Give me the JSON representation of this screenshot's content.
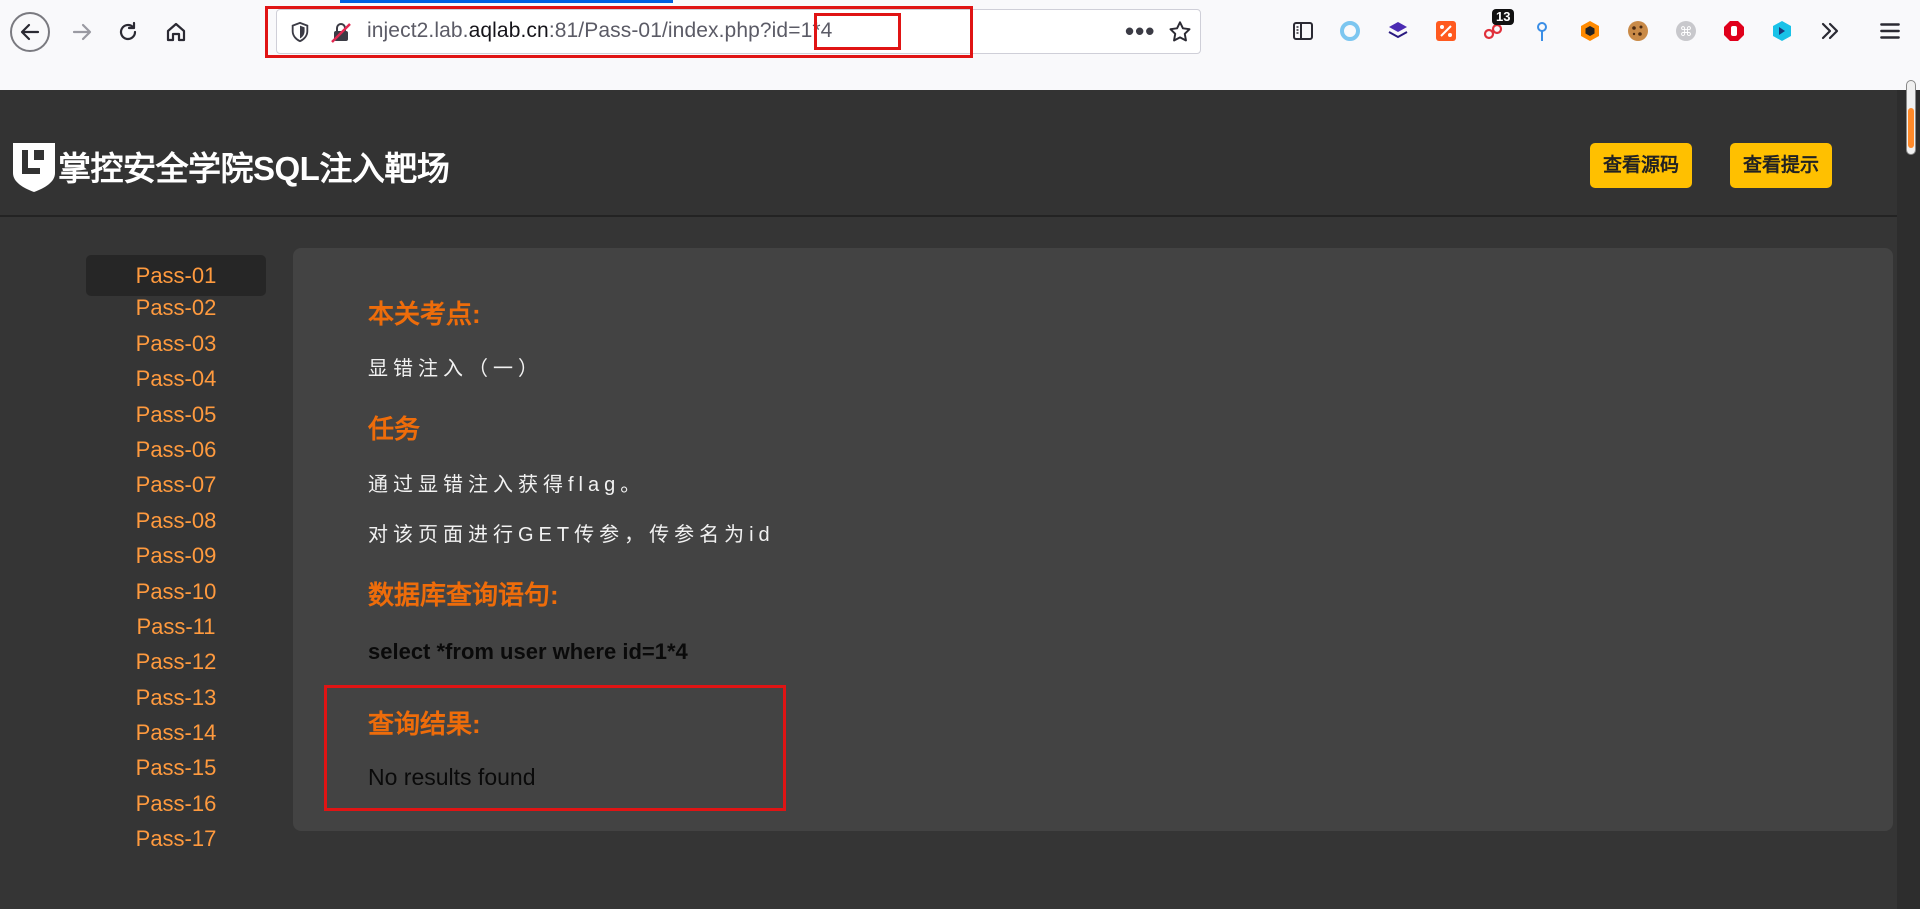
{
  "browser": {
    "url_prefix": "inject2.lab.",
    "url_host": "aqlab.cn",
    "url_suffix": ":81/Pass-01/index.php?id=1*4",
    "extension_badge": "13",
    "more_label": "•••"
  },
  "header": {
    "site_title": "掌控安全学院SQL注入靶场",
    "view_source_label": "查看源码",
    "view_hint_label": "查看提示"
  },
  "sidebar": {
    "items": [
      "Pass-01",
      "Pass-02",
      "Pass-03",
      "Pass-04",
      "Pass-05",
      "Pass-06",
      "Pass-07",
      "Pass-08",
      "Pass-09",
      "Pass-10",
      "Pass-11",
      "Pass-12",
      "Pass-13",
      "Pass-14",
      "Pass-15",
      "Pass-16",
      "Pass-17"
    ],
    "active": "Pass-01"
  },
  "content": {
    "topic_title": "本关考点:",
    "topic_text": "显错注入（一）",
    "task_title": "任务",
    "task_line1": "通过显错注入获得flag。",
    "task_line2": "对该页面进行GET传参，传参名为id",
    "query_title": "数据库查询语句:",
    "query_text": "select *from user where id=1*4",
    "result_title": "查询结果:",
    "result_text": "No results found"
  },
  "colors": {
    "accent_orange": "#ee6c0a",
    "link_orange": "#ff9a3e",
    "button_yellow": "#ffc000",
    "highlight_red": "#e01414"
  }
}
